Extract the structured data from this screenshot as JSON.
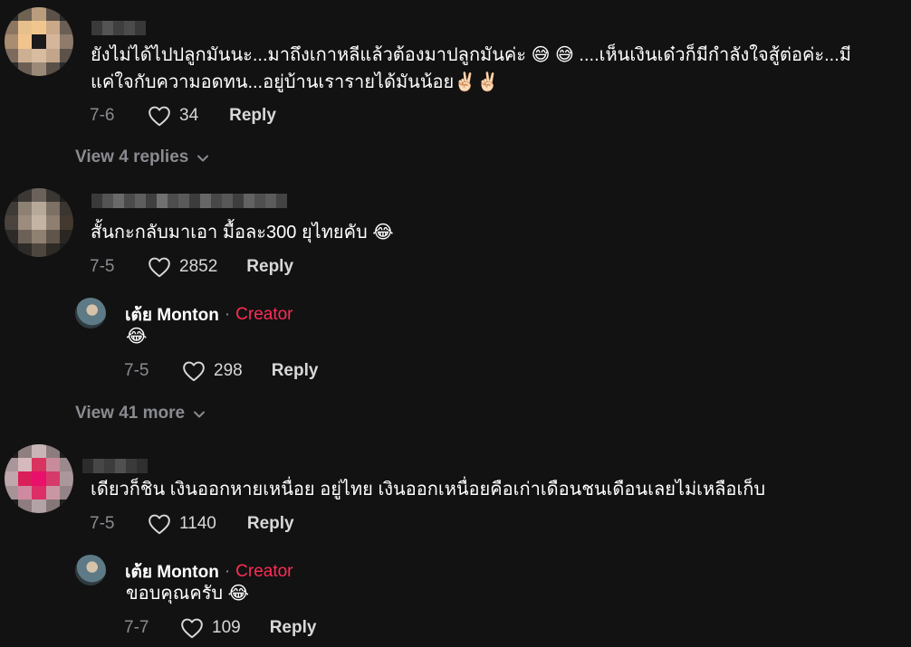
{
  "comments": [
    {
      "text_line1": "ยังไม่ได้ไปปลูกมันนะ...มาถึงเกาหลีแล้วต้องมาปลูกมันค่ะ 😅 😅 ....เห็นเงินเด๋วก็มีกำลังใจสู้ต่อค่ะ...มี",
      "text_line2": "แค่ใจกับความอดทน...อยู่บ้านเรารายได้มันน้อย✌🏻✌🏻",
      "date": "7-6",
      "likes": "34",
      "reply_label": "Reply",
      "view_replies": "View 4 replies"
    },
    {
      "text": "สั้นกะกลับมาเอา มื้อละ300 ยุไทยคับ 😂",
      "date": "7-5",
      "likes": "2852",
      "reply_label": "Reply",
      "reply": {
        "author": "เต้ย Monton",
        "separator": "·",
        "badge": "Creator",
        "text": "😂",
        "date": "7-5",
        "likes": "298",
        "reply_label": "Reply"
      },
      "view_more": "View 41 more"
    },
    {
      "text": "เดียวก็ชิน เงินออกหายเหนื่อย อยู่ไทย เงินออกเหนื่อยคือเก่าเดือนชนเดือนเลยไม่เหลือเก็บ",
      "date": "7-5",
      "likes": "1140",
      "reply_label": "Reply",
      "reply": {
        "author": "เต้ย Monton",
        "separator": "·",
        "badge": "Creator",
        "text": "ขอบคุณครับ 😂",
        "date": "7-7",
        "likes": "109",
        "reply_label": "Reply"
      }
    }
  ],
  "colors": {
    "background": "#121212",
    "text_primary": "#ffffff",
    "text_secondary": "#8a8b91",
    "creator_badge": "#fe2c55"
  },
  "icons": {
    "like": "heart-outline-icon",
    "expand": "chevron-down-icon"
  }
}
